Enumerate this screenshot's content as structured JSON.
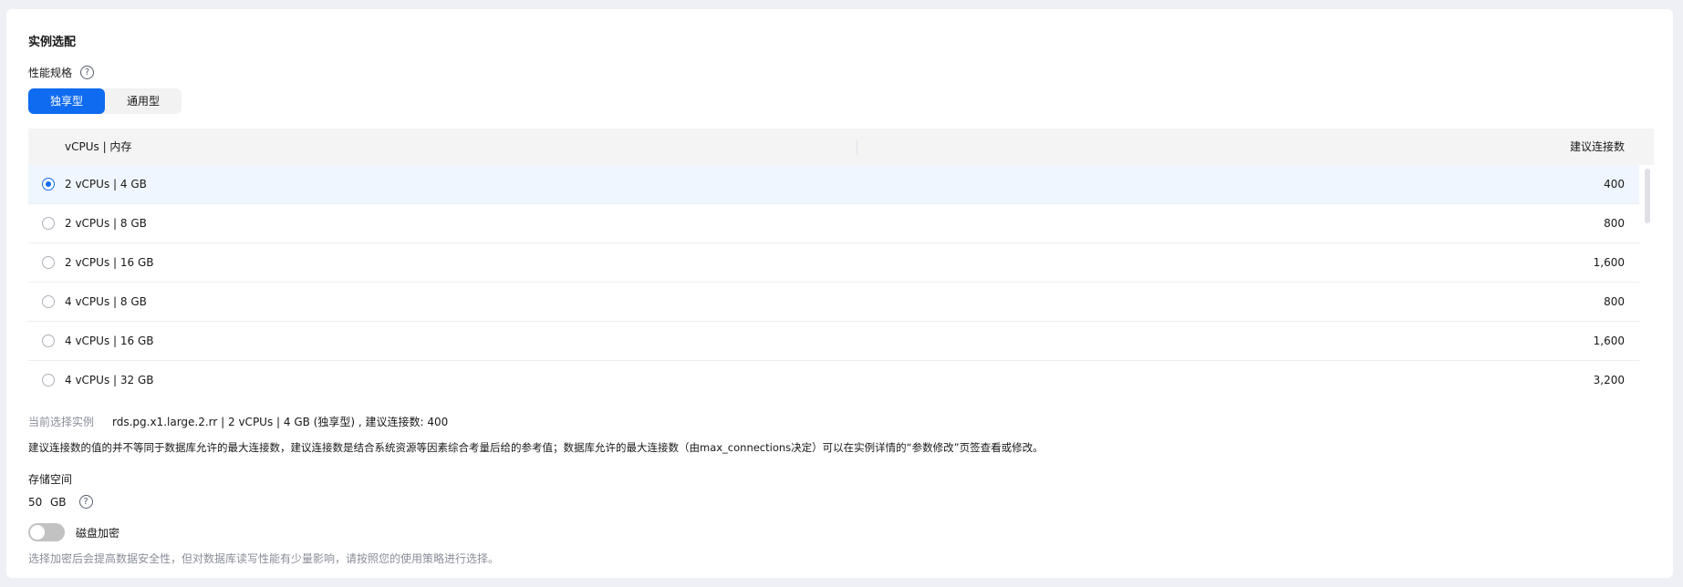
{
  "section_title": "实例选配",
  "performance": {
    "label": "性能规格",
    "help_icon": "?",
    "tabs": [
      {
        "label": "独享型",
        "active": true
      },
      {
        "label": "通用型",
        "active": false
      }
    ]
  },
  "spec_table": {
    "columns": [
      "vCPUs | 内存",
      "建议连接数"
    ],
    "rows": [
      {
        "spec": "2 vCPUs | 4 GB",
        "connections": "400",
        "selected": true
      },
      {
        "spec": "2 vCPUs | 8 GB",
        "connections": "800",
        "selected": false
      },
      {
        "spec": "2 vCPUs | 16 GB",
        "connections": "1,600",
        "selected": false
      },
      {
        "spec": "4 vCPUs | 8 GB",
        "connections": "800",
        "selected": false
      },
      {
        "spec": "4 vCPUs | 16 GB",
        "connections": "1,600",
        "selected": false
      },
      {
        "spec": "4 vCPUs | 32 GB",
        "connections": "3,200",
        "selected": false
      }
    ]
  },
  "current_selection": {
    "label": "当前选择实例",
    "value": "rds.pg.x1.large.2.rr | 2 vCPUs | 4 GB (独享型) , 建议连接数: 400"
  },
  "connection_note": "建议连接数的值的并不等同于数据库允许的最大连接数，建议连接数是结合系统资源等因素综合考量后给的参考值；数据库允许的最大连接数（由max_connections决定）可以在实例详情的“参数修改”页签查看或修改。",
  "storage": {
    "label": "存储空间",
    "value": "50",
    "unit": "GB",
    "help_icon": "?"
  },
  "disk_encryption": {
    "label": "磁盘加密",
    "enabled": false,
    "hint": "选择加密后会提高数据安全性，但对数据库读写性能有少量影响，请按照您的使用策略进行选择。"
  }
}
